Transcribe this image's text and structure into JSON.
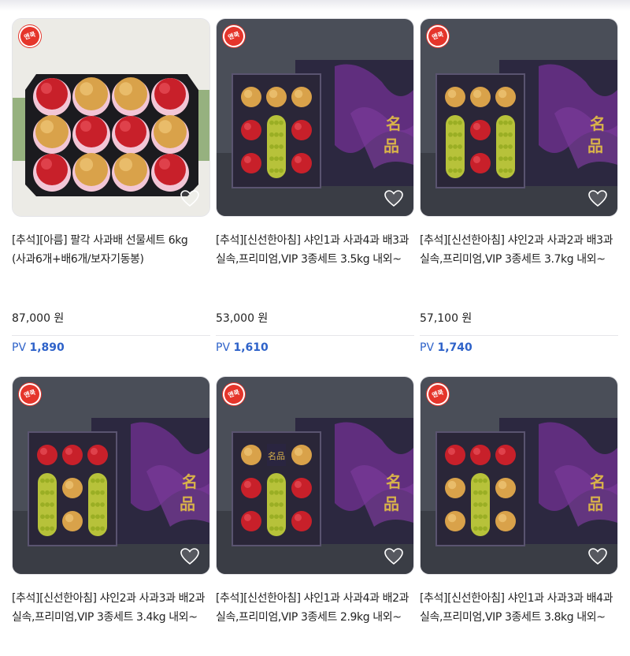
{
  "products": [
    {
      "title": "[추석][아름] 팔각 사과배 선물세트 6kg (사과6개+배6개/보자기동봉)",
      "price": "87,000 원",
      "pv_label": "PV",
      "pv_value": "1,890",
      "badge": "앤쿡",
      "image": "apple-pear-octagon-box",
      "liked": false
    },
    {
      "title": "[추석][신선한아침] 샤인1과 사과4과 배3과 실속,프리미엄,VIP 3종세트 3.5kg 내외~",
      "price": "53,000 원",
      "pv_label": "PV",
      "pv_value": "1,610",
      "badge": "앤쿡",
      "image": "shine-muscat-apple-pear-box",
      "liked": false
    },
    {
      "title": "[추석][신선한아침] 샤인2과 사과2과 배3과 실속,프리미엄,VIP 3종세트 3.7kg 내외~",
      "price": "57,100 원",
      "pv_label": "PV",
      "pv_value": "1,740",
      "badge": "앤쿡",
      "image": "shine-muscat-apple-pear-box",
      "liked": false
    },
    {
      "title": "[추석][신선한아침] 샤인2과 사과3과 배2과 실속,프리미엄,VIP 3종세트 3.4kg 내외~",
      "price": "",
      "pv_label": "",
      "pv_value": "",
      "badge": "앤쿡",
      "image": "shine-muscat-apple-pear-box",
      "liked": false
    },
    {
      "title": "[추석][신선한아침] 샤인1과 사과4과 배2과 실속,프리미엄,VIP 3종세트 2.9kg 내외~",
      "price": "",
      "pv_label": "",
      "pv_value": "",
      "badge": "앤쿡",
      "image": "shine-muscat-apple-pear-box",
      "liked": false
    },
    {
      "title": "[추석][신선한아침] 샤인1과 사과3과 배4과 실속,프리미엄,VIP 3종세트 3.8kg 내외~",
      "price": "",
      "pv_label": "",
      "pv_value": "",
      "badge": "앤쿡",
      "image": "shine-muscat-apple-pear-box",
      "liked": false
    }
  ],
  "colors": {
    "pv": "#2e62c9",
    "badge": "#e5352b",
    "box_purple": "#2f2a4a"
  },
  "icons": {
    "heart": "heart-outline-icon",
    "badge": "brand-badge-icon"
  }
}
